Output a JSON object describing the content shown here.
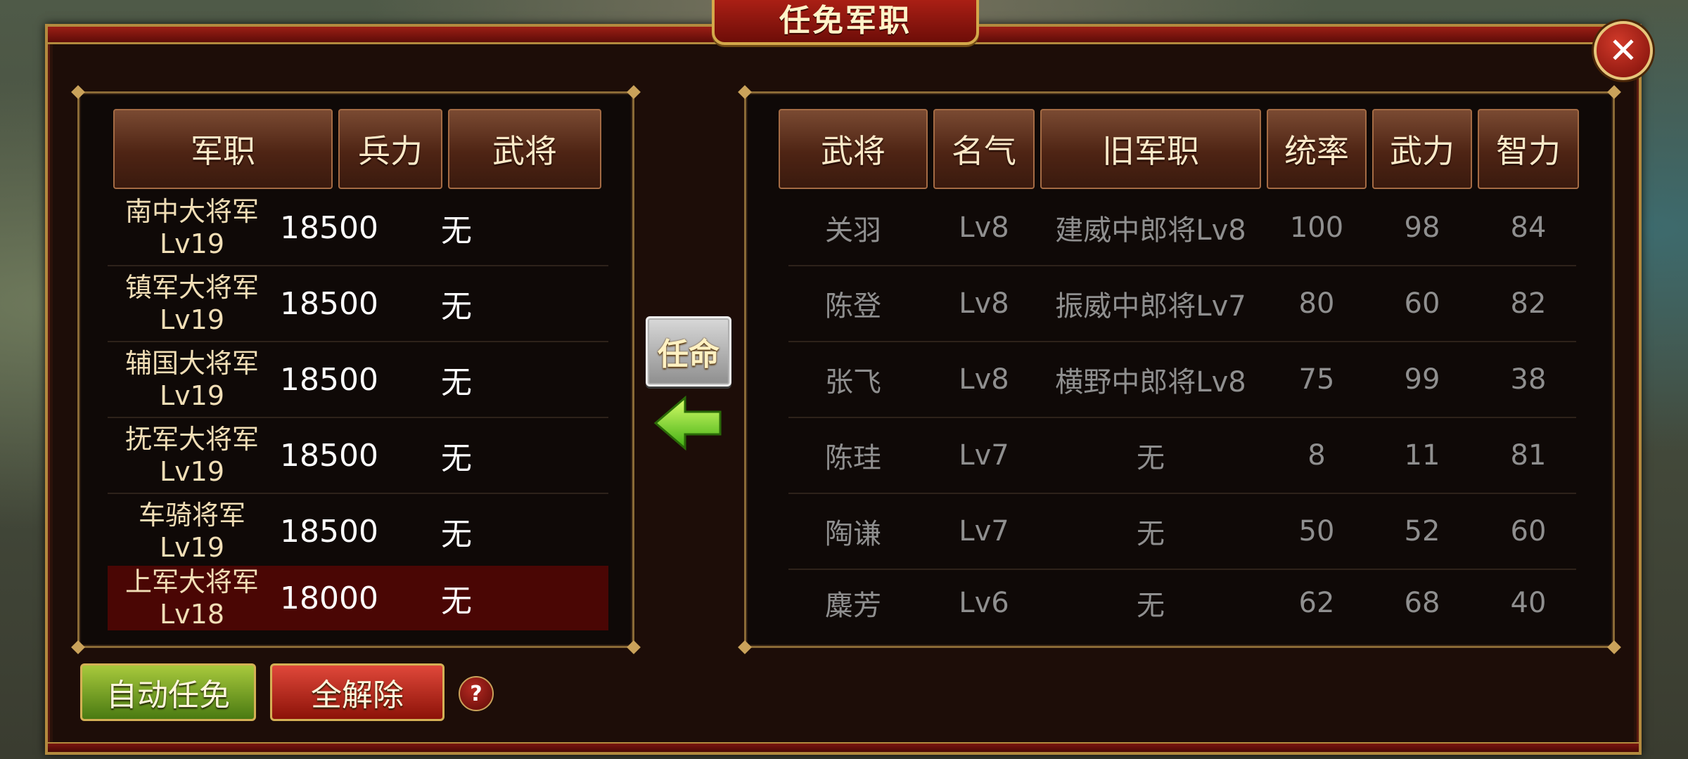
{
  "dialog": {
    "title": "任免军职",
    "close_icon": "close-icon"
  },
  "left_table": {
    "headers": {
      "rank": "军职",
      "troops": "兵力",
      "general": "武将"
    },
    "rows": [
      {
        "rank_line1": "南中大将军",
        "rank_line2": "Lv19",
        "troops": "18500",
        "general": "无",
        "selected": false
      },
      {
        "rank_line1": "镇军大将军",
        "rank_line2": "Lv19",
        "troops": "18500",
        "general": "无",
        "selected": false
      },
      {
        "rank_line1": "辅国大将军",
        "rank_line2": "Lv19",
        "troops": "18500",
        "general": "无",
        "selected": false
      },
      {
        "rank_line1": "抚军大将军",
        "rank_line2": "Lv19",
        "troops": "18500",
        "general": "无",
        "selected": false
      },
      {
        "rank_line1": "车骑将军Lv19",
        "rank_line2": "",
        "troops": "18500",
        "general": "无",
        "selected": false
      },
      {
        "rank_line1": "上军大将军",
        "rank_line2": "Lv18",
        "troops": "18000",
        "general": "无",
        "selected": true
      }
    ]
  },
  "right_table": {
    "headers": {
      "general": "武将",
      "fame": "名气",
      "old_rank": "旧军职",
      "command": "统率",
      "force": "武力",
      "intellect": "智力"
    },
    "rows": [
      {
        "general": "关羽",
        "fame": "Lv8",
        "old_rank": "建威中郎将Lv8",
        "command": "100",
        "force": "98",
        "intellect": "84"
      },
      {
        "general": "陈登",
        "fame": "Lv8",
        "old_rank": "振威中郎将Lv7",
        "command": "80",
        "force": "60",
        "intellect": "82"
      },
      {
        "general": "张飞",
        "fame": "Lv8",
        "old_rank": "横野中郎将Lv8",
        "command": "75",
        "force": "99",
        "intellect": "38"
      },
      {
        "general": "陈珪",
        "fame": "Lv7",
        "old_rank": "无",
        "command": "8",
        "force": "11",
        "intellect": "81"
      },
      {
        "general": "陶谦",
        "fame": "Lv7",
        "old_rank": "无",
        "command": "50",
        "force": "52",
        "intellect": "60"
      },
      {
        "general": "麋芳",
        "fame": "Lv6",
        "old_rank": "无",
        "command": "62",
        "force": "68",
        "intellect": "40"
      }
    ]
  },
  "actions": {
    "appoint": "任命",
    "auto_appoint": "自动任免",
    "dismiss_all": "全解除",
    "help": "?"
  },
  "colors": {
    "accent_gold": "#caa25a",
    "selected_row": "#4a0604",
    "title_red": "#c7281b"
  }
}
